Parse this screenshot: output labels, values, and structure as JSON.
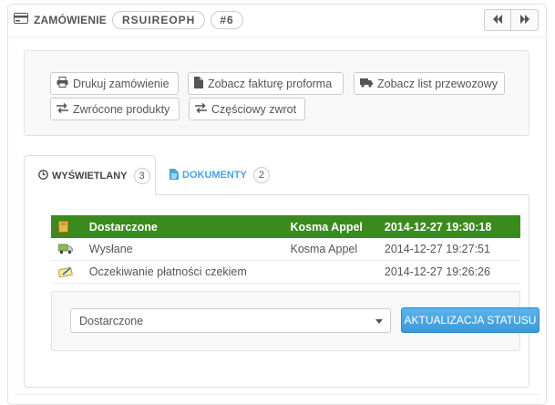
{
  "header": {
    "section_label": "ZAMÓWIENIE",
    "reference": "RSUIREOPH",
    "order_number": "#6",
    "prev_icon": "double-chevron-left-icon",
    "next_icon": "double-chevron-right-icon"
  },
  "actions": {
    "print": "Drukuj zamówienie",
    "proforma": "Zobacz fakturę proforma",
    "delivery_slip": "Zobacz list przewozowy",
    "returned": "Zwrócone produkty",
    "partial_refund": "Częściowy zwrot"
  },
  "tabs": {
    "history": {
      "label": "WYŚWIETLANY",
      "count": "3"
    },
    "documents": {
      "label": "DOKUMENTY",
      "count": "2"
    }
  },
  "history": {
    "rows": [
      {
        "status": "Dostarczone",
        "employee": "Kosma Appel",
        "date": "2014-12-27 19:30:18",
        "icon": "delivered-box-icon"
      },
      {
        "status": "Wysłane",
        "employee": "Kosma Appel",
        "date": "2014-12-27 19:27:51",
        "icon": "truck-icon"
      },
      {
        "status": "Oczekiwanie płatności czekiem",
        "employee": "",
        "date": "2014-12-27 19:26:26",
        "icon": "cheque-icon"
      }
    ],
    "current_color": "#3b8a1e"
  },
  "status_form": {
    "selected": "Dostarczone",
    "submit_label": "AKTUALIZACJA STATUSU"
  },
  "colors": {
    "accent": "#4aa3df",
    "primary_button": "#3b9ad9",
    "current_status": "#3b8a1e"
  }
}
